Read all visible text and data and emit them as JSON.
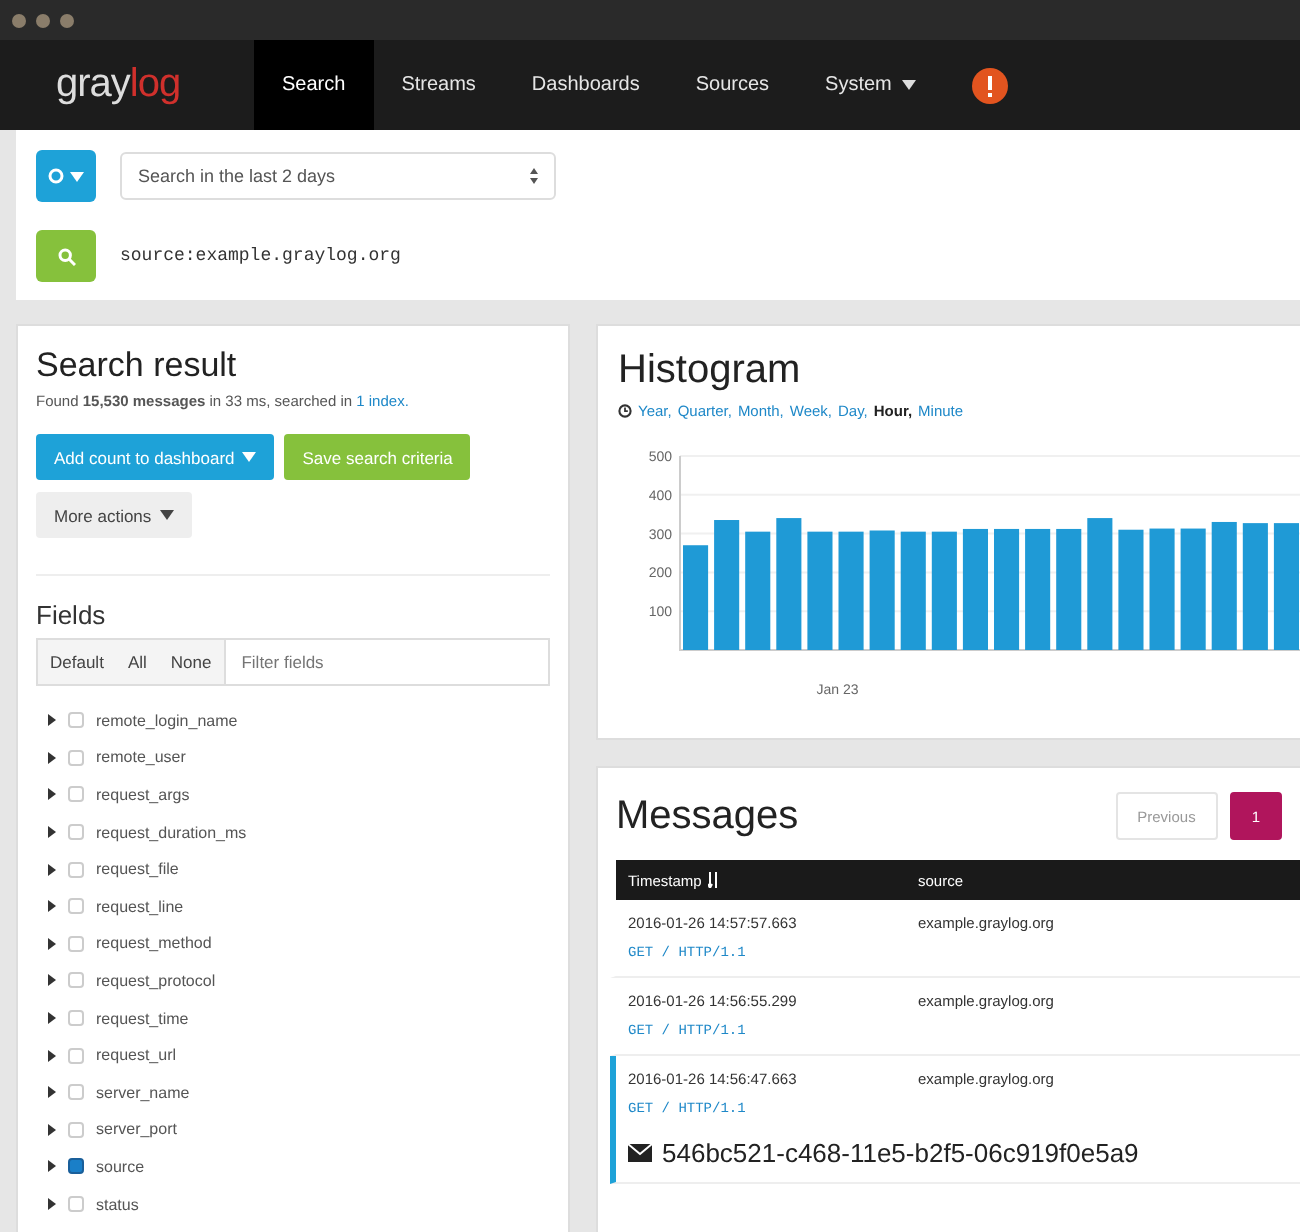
{
  "nav": {
    "logo": {
      "first": "gray",
      "second": "log"
    },
    "items": [
      {
        "label": "Search",
        "selected": true,
        "dropdown": false
      },
      {
        "label": "Streams",
        "selected": false,
        "dropdown": false
      },
      {
        "label": "Dashboards",
        "selected": false,
        "dropdown": false
      },
      {
        "label": "Sources",
        "selected": false,
        "dropdown": false
      },
      {
        "label": "System",
        "selected": false,
        "dropdown": true
      }
    ]
  },
  "search": {
    "time_range": "Search in the last 2 days",
    "query": "source:example.graylog.org"
  },
  "result": {
    "title": "Search result",
    "summary": "Found **15,530 messages** in 33 ms, searched in",
    "summary_link": "1 index.",
    "buttons": [
      {
        "label": "Add count to dashboard",
        "kind": "primary",
        "dropdown": true
      },
      {
        "label": "Save search criteria",
        "kind": "success",
        "dropdown": false
      },
      {
        "label": "More actions",
        "kind": "default",
        "dropdown": true
      }
    ]
  },
  "fields": {
    "title": "Fields",
    "filters": [
      "Default",
      "All",
      "None"
    ],
    "placeholder": "Filter fields",
    "items": [
      {
        "name": "remote_login_name",
        "checked": false
      },
      {
        "name": "remote_user",
        "checked": false
      },
      {
        "name": "request_args",
        "checked": false
      },
      {
        "name": "request_duration_ms",
        "checked": false
      },
      {
        "name": "request_file",
        "checked": false
      },
      {
        "name": "request_line",
        "checked": false
      },
      {
        "name": "request_method",
        "checked": false
      },
      {
        "name": "request_protocol",
        "checked": false
      },
      {
        "name": "request_time",
        "checked": false
      },
      {
        "name": "request_url",
        "checked": false
      },
      {
        "name": "server_name",
        "checked": false
      },
      {
        "name": "server_port",
        "checked": false
      },
      {
        "name": "source",
        "checked": true
      },
      {
        "name": "status",
        "checked": false
      }
    ]
  },
  "histogram": {
    "title": "Histogram",
    "resolutions": [
      {
        "label": "Year,",
        "selected": false
      },
      {
        "label": "Quarter,",
        "selected": false
      },
      {
        "label": "Month,",
        "selected": false
      },
      {
        "label": "Week,",
        "selected": false
      },
      {
        "label": "Day,",
        "selected": false
      },
      {
        "label": "Hour,",
        "selected": true
      },
      {
        "label": "Minute",
        "selected": false
      }
    ],
    "date_label": "Jan 23",
    "chart_data": {
      "type": "bar",
      "values": [
        270,
        335,
        305,
        340,
        305,
        305,
        308,
        305,
        305,
        312,
        312,
        312,
        312,
        340,
        310,
        313,
        313,
        330,
        327,
        327
      ],
      "grid": true,
      "ylim": [
        0,
        500
      ],
      "yticks": [
        {
          "value": 100,
          "label": "100"
        },
        {
          "value": 200,
          "label": "200"
        },
        {
          "value": 300,
          "label": "300"
        },
        {
          "value": 400,
          "label": "400"
        },
        {
          "value": 500,
          "label": "500"
        }
      ]
    }
  },
  "messages": {
    "title": "Messages",
    "pagination": [
      {
        "label": "Previous",
        "selected": false
      },
      {
        "label": "1",
        "selected": true
      }
    ],
    "columns": [
      "Timestamp",
      "source"
    ],
    "rows": [
      {
        "timestamp": "2016-01-26 14:57:57.663",
        "source": "example.graylog.org",
        "summary": "GET / HTTP/1.1",
        "selected": false
      },
      {
        "timestamp": "2016-01-26 14:56:55.299",
        "source": "example.graylog.org",
        "summary": "GET / HTTP/1.1",
        "selected": false
      },
      {
        "timestamp": "2016-01-26 14:56:47.663",
        "source": "example.graylog.org",
        "summary": "GET / HTTP/1.1",
        "selected": true,
        "id": "546bc521-c468-11e5-b2f5-06c919f0e5a9"
      }
    ]
  }
}
